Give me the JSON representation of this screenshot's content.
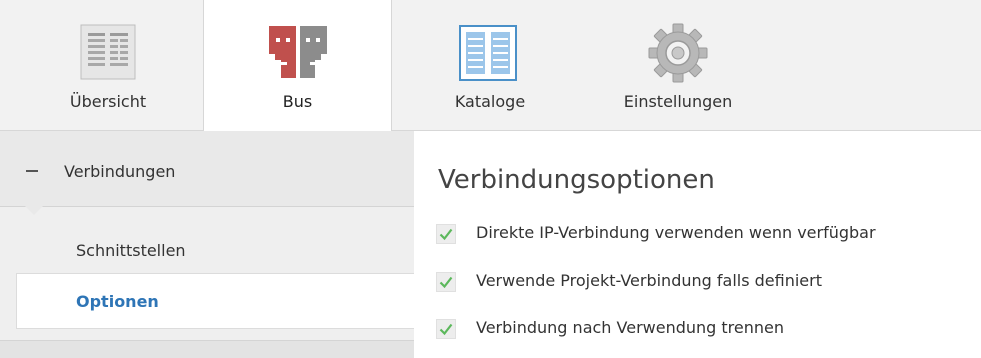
{
  "ribbon": {
    "tabs": [
      {
        "label": "Übersicht",
        "icon": "overview-icon"
      },
      {
        "label": "Bus",
        "icon": "bus-icon"
      },
      {
        "label": "Kataloge",
        "icon": "catalog-icon"
      },
      {
        "label": "Einstellungen",
        "icon": "gear-icon"
      }
    ],
    "active_tab": "Bus"
  },
  "sidebar": {
    "section_label": "Verbindungen",
    "items": [
      {
        "label": "Schnittstellen"
      },
      {
        "label": "Optionen"
      }
    ],
    "selected_item": "Optionen"
  },
  "main": {
    "title": "Verbindungsoptionen",
    "options": [
      {
        "label": "Direkte IP-Verbindung verwenden wenn verfügbar",
        "checked": true
      },
      {
        "label": "Verwende Projekt-Verbindung falls definiert",
        "checked": true
      },
      {
        "label": "Verbindung nach Verwendung trennen",
        "checked": true
      }
    ]
  },
  "colors": {
    "accent": "#2e75b6",
    "check": "#5cb85c",
    "bus_icon_red": "#c0504d",
    "bus_icon_gray": "#8c8c8c"
  }
}
